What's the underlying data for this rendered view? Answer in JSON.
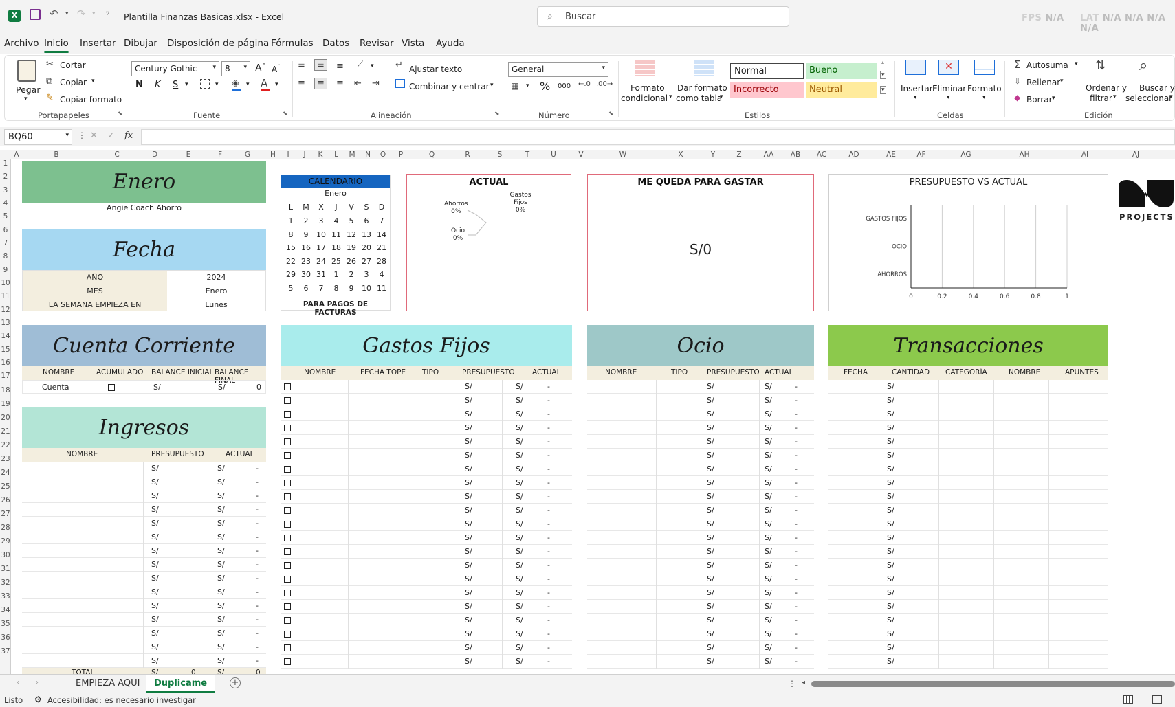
{
  "app": {
    "title": "Plantilla Finanzas Basicas.xlsx  -  Excel",
    "search_placeholder": "Buscar",
    "fps_label": "FPS",
    "fps_value": "N/A",
    "lat_label": "LAT",
    "lat_values": [
      "N/A",
      "N/A",
      "N/A",
      "N/A"
    ]
  },
  "menu": [
    "Archivo",
    "Inicio",
    "Insertar",
    "Dibujar",
    "Disposición de página",
    "Fórmulas",
    "Datos",
    "Revisar",
    "Vista",
    "Ayuda"
  ],
  "ribbon": {
    "clipboard": {
      "paste": "Pegar",
      "cut": "Cortar",
      "copy": "Copiar",
      "format_painter": "Copiar formato",
      "label": "Portapapeles"
    },
    "font": {
      "family": "Century Gothic",
      "size": "8",
      "label": "Fuente",
      "bold": "N",
      "italic": "K",
      "underline": "S"
    },
    "alignment": {
      "wrap": "Ajustar texto",
      "merge": "Combinar y centrar",
      "label": "Alineación"
    },
    "number": {
      "format": "General",
      "label": "Número",
      "percent": "%",
      "thousands": "000"
    },
    "styles": {
      "cond_format": [
        "Formato",
        "condicional"
      ],
      "format_table": [
        "Dar formato",
        "como tabla"
      ],
      "normal": "Normal",
      "good": "Bueno",
      "bad": "Incorrecto",
      "neutral": "Neutral",
      "label": "Estilos"
    },
    "cells": {
      "insert": "Insertar",
      "delete": "Eliminar",
      "format": "Formato",
      "label": "Celdas"
    },
    "editing": {
      "autosum": "Autosuma",
      "fill": "Rellenar",
      "clear": "Borrar",
      "sort": [
        "Ordenar y",
        "filtrar"
      ],
      "find": [
        "Buscar y",
        "seleccionar"
      ],
      "label": "Edición"
    }
  },
  "formula_bar": {
    "name_box": "BQ60",
    "fx": "fx"
  },
  "columns": [
    "A",
    "B",
    "C",
    "D",
    "E",
    "F",
    "G",
    "H",
    "I",
    "J",
    "K",
    "L",
    "M",
    "N",
    "O",
    "P",
    "Q",
    "R",
    "S",
    "T",
    "U",
    "V",
    "W",
    "X",
    "Y",
    "Z",
    "AA",
    "AB",
    "AC",
    "AD",
    "AE",
    "AF",
    "AG",
    "AH",
    "AI",
    "AJ"
  ],
  "rows": [
    "1",
    "2",
    "3",
    "4",
    "5",
    "6",
    "7",
    "8",
    "9",
    "10",
    "11",
    "12",
    "13",
    "14",
    "15",
    "16",
    "17",
    "18",
    "19",
    "20",
    "21",
    "22",
    "23",
    "24",
    "25",
    "26",
    "27",
    "28",
    "29",
    "30",
    "31",
    "32",
    "33",
    "34",
    "35",
    "36",
    "37"
  ],
  "sheet": {
    "month_title": "Enero",
    "author": "Angie Coach Ahorro",
    "fecha_title": "Fecha",
    "fecha_rows": [
      {
        "label": "AÑO",
        "value": "2024"
      },
      {
        "label": "MES",
        "value": "Enero"
      },
      {
        "label": "LA SEMANA EMPIEZA EN",
        "value": "Lunes"
      }
    ],
    "calendar": {
      "title": "CALENDARIO",
      "month": "Enero",
      "weekdays": [
        "L",
        "M",
        "X",
        "J",
        "V",
        "S",
        "D"
      ],
      "weeks": [
        [
          "1",
          "2",
          "3",
          "4",
          "5",
          "6",
          "7"
        ],
        [
          "8",
          "9",
          "10",
          "11",
          "12",
          "13",
          "14"
        ],
        [
          "15",
          "16",
          "17",
          "18",
          "19",
          "20",
          "21"
        ],
        [
          "22",
          "23",
          "24",
          "25",
          "26",
          "27",
          "28"
        ],
        [
          "29",
          "30",
          "31",
          "1",
          "2",
          "3",
          "4"
        ],
        [
          "5",
          "6",
          "7",
          "8",
          "9",
          "10",
          "11"
        ]
      ],
      "footer": "PARA PAGOS DE FACTURAS"
    },
    "actual": {
      "title": "ACTUAL",
      "labels": [
        {
          "name": "Ahorros",
          "pct": "0%"
        },
        {
          "name": "Ocio",
          "pct": "0%"
        },
        {
          "name": "Gastos Fijos",
          "pct": "0%"
        }
      ]
    },
    "me_queda": {
      "title": "ME QUEDA PARA GASTAR",
      "value": "S/0"
    },
    "presupuesto_chart": {
      "title": "PRESUPUESTO VS ACTUAL",
      "categories": [
        "GASTOS FIJOS",
        "OCIO",
        "AHORROS"
      ],
      "x_ticks": [
        "0",
        "0.2",
        "0.4",
        "0.6",
        "0.8",
        "1"
      ]
    },
    "logo_text": "PROJECTS",
    "cuenta": {
      "title": "Cuenta Corriente",
      "headers": [
        "NOMBRE",
        "ACUMULADO",
        "BALANCE INICIAL",
        "BALANCE FINAL"
      ],
      "row": {
        "name": "Cuenta",
        "currency": "S/",
        "final": "0"
      }
    },
    "ingresos": {
      "title": "Ingresos",
      "headers": [
        "NOMBRE",
        "PRESUPUESTO",
        "ACTUAL"
      ],
      "currency": "S/",
      "dash": "-",
      "rows": 15,
      "total_label": "TOTAL",
      "total_value": "0"
    },
    "gastos": {
      "title": "Gastos Fijos",
      "headers": [
        "NOMBRE",
        "FECHA TOPE",
        "TIPO",
        "PRESUPUESTO",
        "ACTUAL"
      ],
      "currency": "S/",
      "dash": "-"
    },
    "ocio": {
      "title": "Ocio",
      "headers": [
        "NOMBRE",
        "TIPO",
        "PRESUPUESTO",
        "ACTUAL"
      ],
      "currency": "S/",
      "dash": "-"
    },
    "transacciones": {
      "title": "Transacciones",
      "headers": [
        "FECHA",
        "CANTIDAD",
        "CATEGORÍA",
        "NOMBRE",
        "APUNTES"
      ],
      "currency": "S/"
    }
  },
  "tabs": [
    "EMPIEZA AQUI",
    "Duplicame"
  ],
  "status": {
    "ready": "Listo",
    "accessibility": "Accesibilidad: es necesario investigar"
  },
  "colors": {
    "green_banner": "#7dc08f",
    "blue_banner": "#a6d8f2",
    "steel_banner": "#9fbdd6",
    "mint_banner": "#b3e5d6",
    "cyan_banner": "#a9ecec",
    "teal_banner": "#9ec8c8",
    "lime_banner": "#8cc94c",
    "calendar_blue": "#1565c0",
    "excel_green": "#107c41"
  }
}
